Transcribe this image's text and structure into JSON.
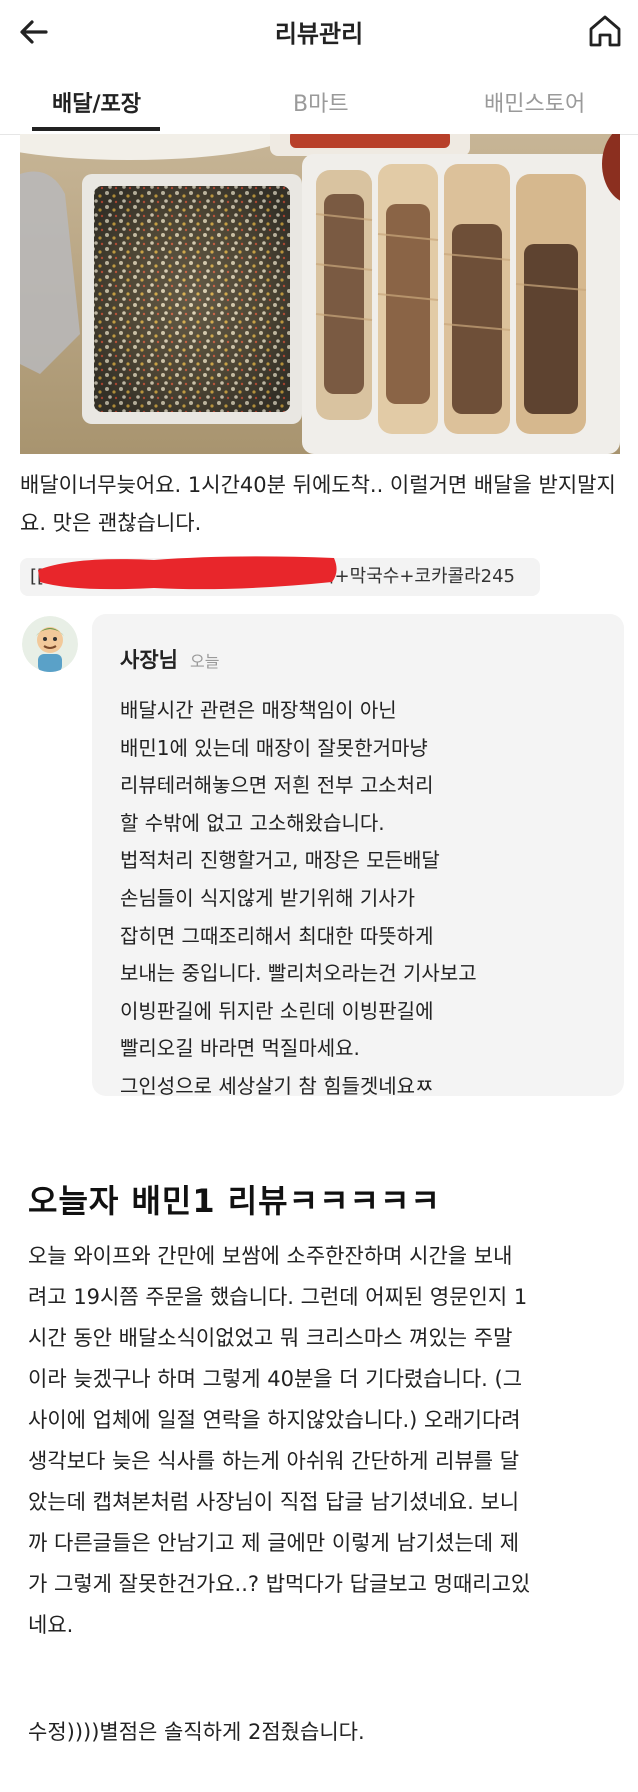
{
  "header": {
    "title": "리뷰관리",
    "back_icon": "arrow-left-icon",
    "home_icon": "home-icon"
  },
  "tabs": [
    {
      "label": "배달/포장",
      "active": true
    },
    {
      "label": "B마트",
      "active": false
    },
    {
      "label": "배민스토어",
      "active": false
    }
  ],
  "review": {
    "text": "배달이너무늦어요. 1시간40분 뒤에도착.. 이럴거면 배달을 받지말지요. 맛은 괜찮습니다.",
    "menu_prefix": "[[",
    "menu_tag": "치+막국수+코카콜라245"
  },
  "reply": {
    "author": "사장님",
    "date": "오늘",
    "lines": [
      "배달시간 관련은 매장책임이 아닌",
      "배민1에 있는데 매장이 잘못한거마냥",
      "리뷰테러해놓으면 저흰 전부 고소처리",
      "할 수밖에 없고 고소해왔습니다.",
      "법적처리 진행할거고, 매장은 모든배달",
      "손님들이 식지않게 받기위해 기사가",
      "잡히면 그때조리해서 최대한 따뜻하게",
      "보내는 중입니다. 빨리처오라는건 기사보고",
      "이빙판길에 뒤지란 소린데 이빙판길에",
      "빨리오길 바라면 먹질마세요.",
      "그인성으로 세상살기 참 힘들겟네요ㅉ"
    ]
  },
  "post": {
    "title": "오늘자 배민1  리뷰ㅋㅋㅋㅋㅋ",
    "lines": [
      "오늘 와이프와 간만에 보쌈에 소주한잔하며 시간을 보내",
      "려고 19시쯤 주문을 했습니다. 그런데 어찌된 영문인지 1",
      "시간 동안 배달소식이없었고 뭐 크리스마스 껴있는 주말",
      "이라 늦겠구나 하며 그렇게 40분을 더 기다렸습니다. (그",
      "사이에 업체에 일절 연락을 하지않았습니다.)  오래기다려",
      "생각보다 늦은 식사를 하는게 아쉬워 간단하게 리뷰를 달",
      "았는데 캡쳐본처럼 사장님이 직접 답글 남기셨네요.  보니",
      "까 다른글들은 안남기고 제 글에만 이렇게 남기셨는데 제",
      "가 그렇게 잘못한건가요..? 밥먹다가 답글보고 멍때리고있",
      "네요."
    ],
    "edit": "수정))))별점은 솔직하게 2점줬습니다."
  },
  "colors": {
    "accent": "#222222",
    "muted": "#9a9a9a",
    "bubble": "#f4f4f4",
    "redact": "#e8262b"
  }
}
